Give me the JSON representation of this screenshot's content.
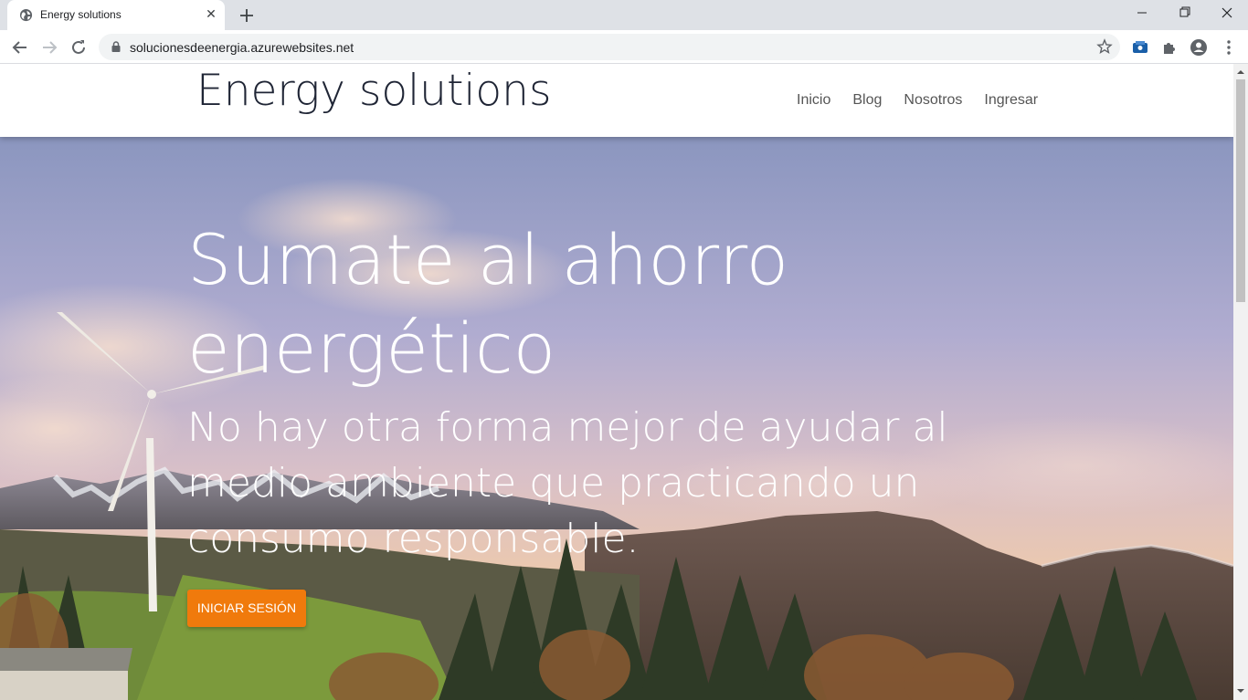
{
  "browser": {
    "tab_title": "Energy solutions",
    "url": "solucionesdeenergia.azurewebsites.net"
  },
  "site": {
    "brand": "Energy solutions",
    "nav": [
      "Inicio",
      "Blog",
      "Nosotros",
      "Ingresar"
    ]
  },
  "hero": {
    "title": "Sumate al ahorro energético",
    "subtitle": "No hay otra forma mejor de ayudar al medio ambiente que practicando un consumo responsable.",
    "cta_label": "INICIAR SESIÓN"
  },
  "colors": {
    "cta": "#f07a0c",
    "brand_text": "#1f2535"
  }
}
